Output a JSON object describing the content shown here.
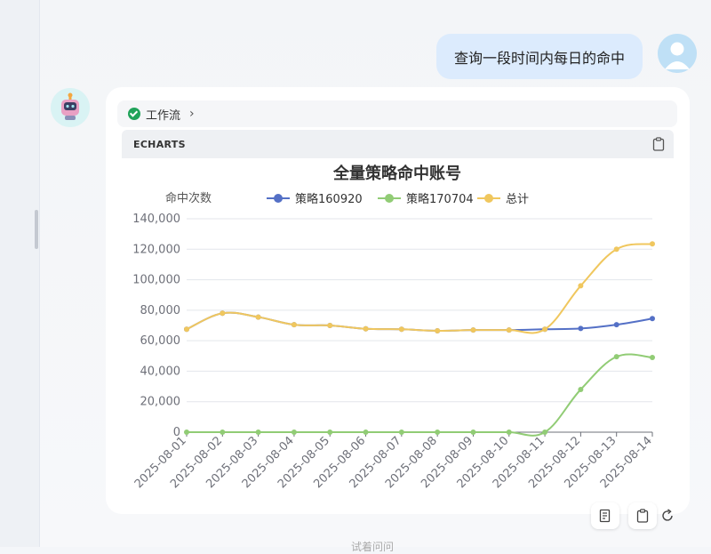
{
  "conversation": {
    "user_message": "查询一段时间内每日的命中",
    "workflow_label": "工作流",
    "bottom_hint": "试着问问"
  },
  "chart_panel": {
    "header": "ECHARTS"
  },
  "icons": {
    "workflow_status": "check-circle-icon",
    "workflow_expand": "chevron-right-icon",
    "copy": "clipboard-icon",
    "report": "document-icon",
    "regenerate": "refresh-icon"
  },
  "colors": {
    "series_160920": "#5470c6",
    "series_170704": "#91cc75",
    "series_total": "#f0c75e",
    "user_bubble": "#dcebfd",
    "workflow_ok": "#21a35a"
  },
  "chart_data": {
    "type": "line",
    "title": "全量策略命中账号",
    "ylabel": "命中次数",
    "xlabel": "",
    "ylim": [
      0,
      140000
    ],
    "yticks": [
      "0",
      "20,000",
      "40,000",
      "60,000",
      "80,000",
      "100,000",
      "120,000",
      "140,000"
    ],
    "legend_position": "top",
    "categories": [
      "2025-08-01",
      "2025-08-02",
      "2025-08-03",
      "2025-08-04",
      "2025-08-05",
      "2025-08-06",
      "2025-08-07",
      "2025-08-08",
      "2025-08-09",
      "2025-08-10",
      "2025-08-11",
      "2025-08-12",
      "2025-08-13",
      "2025-08-14"
    ],
    "series": [
      {
        "name": "策略160920",
        "color": "#5470c6",
        "values": [
          67500,
          78000,
          75500,
          70500,
          70000,
          67800,
          67500,
          66500,
          67000,
          67000,
          67500,
          68000,
          70500,
          74500
        ]
      },
      {
        "name": "策略170704",
        "color": "#91cc75",
        "values": [
          0,
          0,
          0,
          0,
          0,
          0,
          0,
          0,
          0,
          0,
          0,
          28000,
          49500,
          49000
        ]
      },
      {
        "name": "总计",
        "color": "#f0c75e",
        "values": [
          67500,
          78000,
          75500,
          70500,
          70000,
          67800,
          67500,
          66500,
          67000,
          67000,
          67500,
          96000,
          120000,
          123500
        ]
      }
    ]
  }
}
